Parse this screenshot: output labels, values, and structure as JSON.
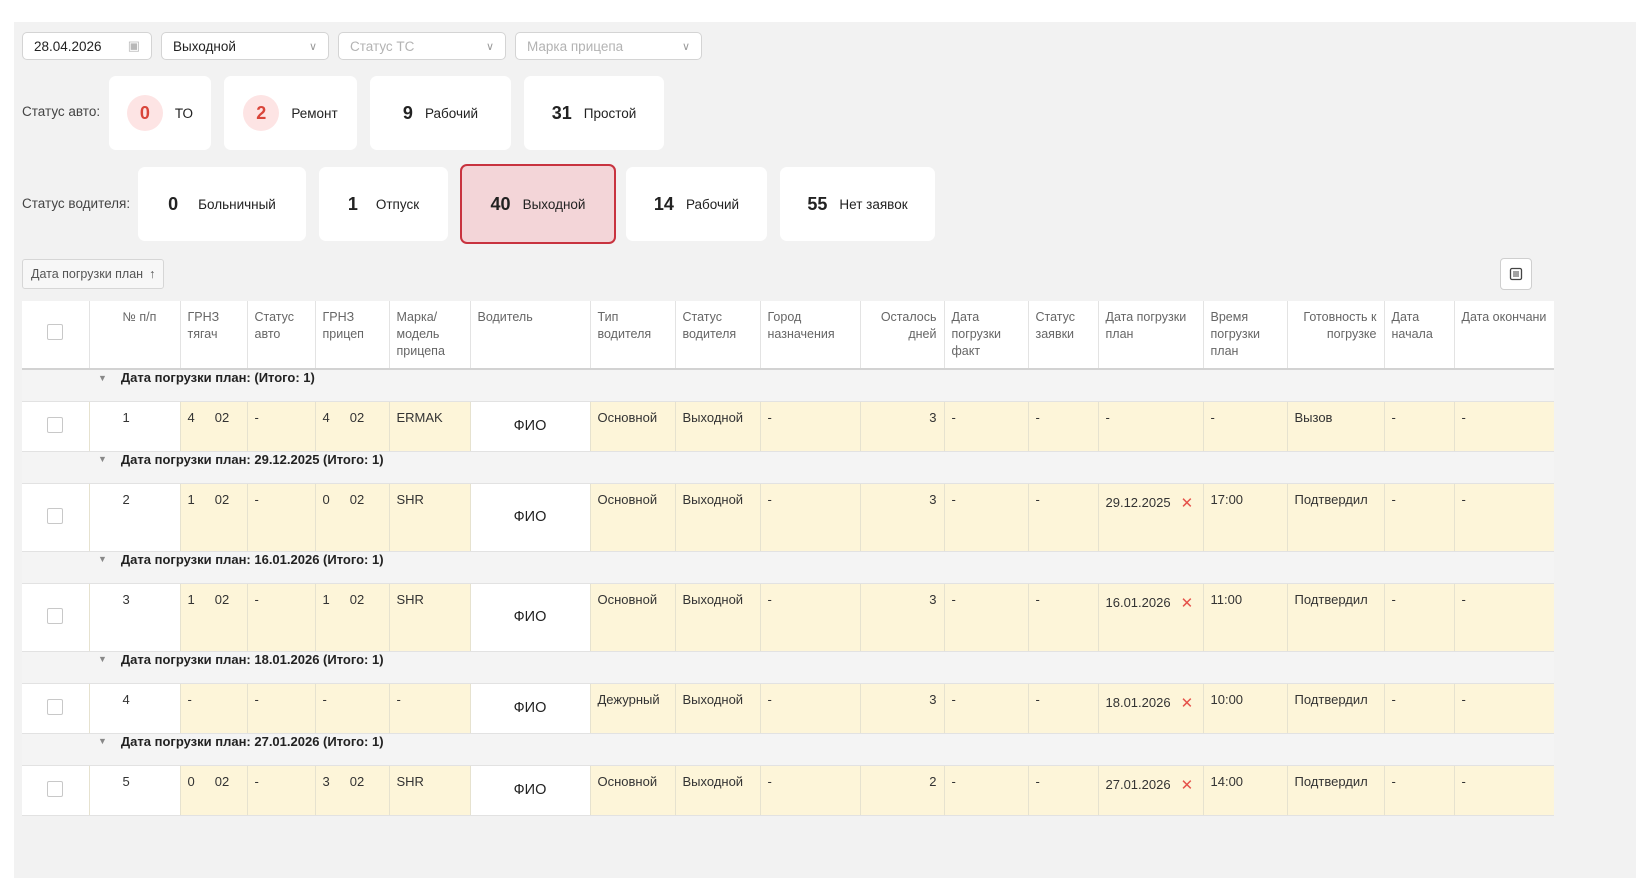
{
  "filters": {
    "date": "28.04.2026",
    "day_type": "Выходной",
    "vehicle_status_placeholder": "Статус ТС",
    "trailer_brand_placeholder": "Марка прицепа"
  },
  "auto_status": {
    "label": "Статус авто:",
    "cards": [
      {
        "count": "0",
        "label": "ТО"
      },
      {
        "count": "2",
        "label": "Ремонт"
      },
      {
        "count": "9",
        "label": "Рабочий"
      },
      {
        "count": "31",
        "label": "Простой"
      }
    ]
  },
  "driver_status": {
    "label": "Статус водителя:",
    "cards": [
      {
        "count": "0",
        "label": "Больничный"
      },
      {
        "count": "1",
        "label": "Отпуск"
      },
      {
        "count": "40",
        "label": "Выходной"
      },
      {
        "count": "14",
        "label": "Рабочий"
      },
      {
        "count": "55",
        "label": "Нет заявок"
      }
    ]
  },
  "sort_chip": {
    "label": "Дата погрузки план",
    "arrow": "↑"
  },
  "table": {
    "headers": {
      "num": "№ п/п",
      "grnz_tractor": "ГРНЗ тягач",
      "auto_status": "Статус авто",
      "grnz_trailer": "ГРНЗ прицеп",
      "trailer_model": "Марка/ модель прицепа",
      "driver": "Водитель",
      "driver_type": "Тип водителя",
      "driver_status": "Статус водителя",
      "destination": "Город назначения",
      "days_left": "Осталось дней",
      "load_fact": "Дата погрузки факт",
      "request_status": "Статус заявки",
      "load_plan": "Дата погрузки план",
      "load_time": "Время погрузки план",
      "readiness": "Готовность к погрузке",
      "start_date": "Дата начала",
      "end_date": "Дата окончани"
    },
    "groups": [
      {
        "title": "Дата погрузки план: (Итого: 1)",
        "row": {
          "num": "1",
          "tractor_a": "4",
          "tractor_b": "02",
          "auto_status": "-",
          "trailer_a": "4",
          "trailer_b": "02",
          "model": "ERMAK",
          "driver": "ФИО",
          "driver_type": "Основной",
          "driver_status": "Выходной",
          "city": "-",
          "days": "3",
          "fact": "-",
          "req": "-",
          "plan": "-",
          "has_x": false,
          "time": "-",
          "ready": "Вызов",
          "start": "-",
          "end": "-"
        }
      },
      {
        "title": "Дата погрузки план: 29.12.2025 (Итого: 1)",
        "row": {
          "num": "2",
          "tractor_a": "1",
          "tractor_b": "02",
          "auto_status": "-",
          "trailer_a": "0",
          "trailer_b": "02",
          "model": "SHR",
          "driver": "ФИО",
          "driver_type": "Основной",
          "driver_status": "Выходной",
          "city": "-",
          "days": "3",
          "fact": "-",
          "req": "-",
          "plan": "29.12.2025",
          "has_x": true,
          "time": "17:00",
          "ready": "Подтвердил",
          "start": "-",
          "end": "-"
        }
      },
      {
        "title": "Дата погрузки план: 16.01.2026 (Итого: 1)",
        "row": {
          "num": "3",
          "tractor_a": "1",
          "tractor_b": "02",
          "auto_status": "-",
          "trailer_a": "1",
          "trailer_b": "02",
          "model": "SHR",
          "driver": "ФИО",
          "driver_type": "Основной",
          "driver_status": "Выходной",
          "city": "-",
          "days": "3",
          "fact": "-",
          "req": "-",
          "plan": "16.01.2026",
          "has_x": true,
          "time": "11:00",
          "ready": "Подтвердил",
          "start": "-",
          "end": "-"
        }
      },
      {
        "title": "Дата погрузки план: 18.01.2026 (Итого: 1)",
        "row": {
          "num": "4",
          "tractor_a": "-",
          "tractor_b": "",
          "auto_status": "-",
          "trailer_a": "-",
          "trailer_b": "",
          "model": "-",
          "driver": "ФИО",
          "driver_type": "Дежурный",
          "driver_status": "Выходной",
          "city": "-",
          "days": "3",
          "fact": "-",
          "req": "-",
          "plan": "18.01.2026",
          "has_x": true,
          "time": "10:00",
          "ready": "Подтвердил",
          "start": "-",
          "end": "-"
        }
      },
      {
        "title": "Дата погрузки план: 27.01.2026 (Итого: 1)",
        "row": {
          "num": "5",
          "tractor_a": "0",
          "tractor_b": "02",
          "auto_status": "-",
          "trailer_a": "3",
          "trailer_b": "02",
          "model": "SHR",
          "driver": "ФИО",
          "driver_type": "Основной",
          "driver_status": "Выходной",
          "city": "-",
          "days": "2",
          "fact": "-",
          "req": "-",
          "plan": "27.01.2026",
          "has_x": true,
          "time": "14:00",
          "ready": "Подтвердил",
          "start": "-",
          "end": "-"
        }
      }
    ]
  }
}
